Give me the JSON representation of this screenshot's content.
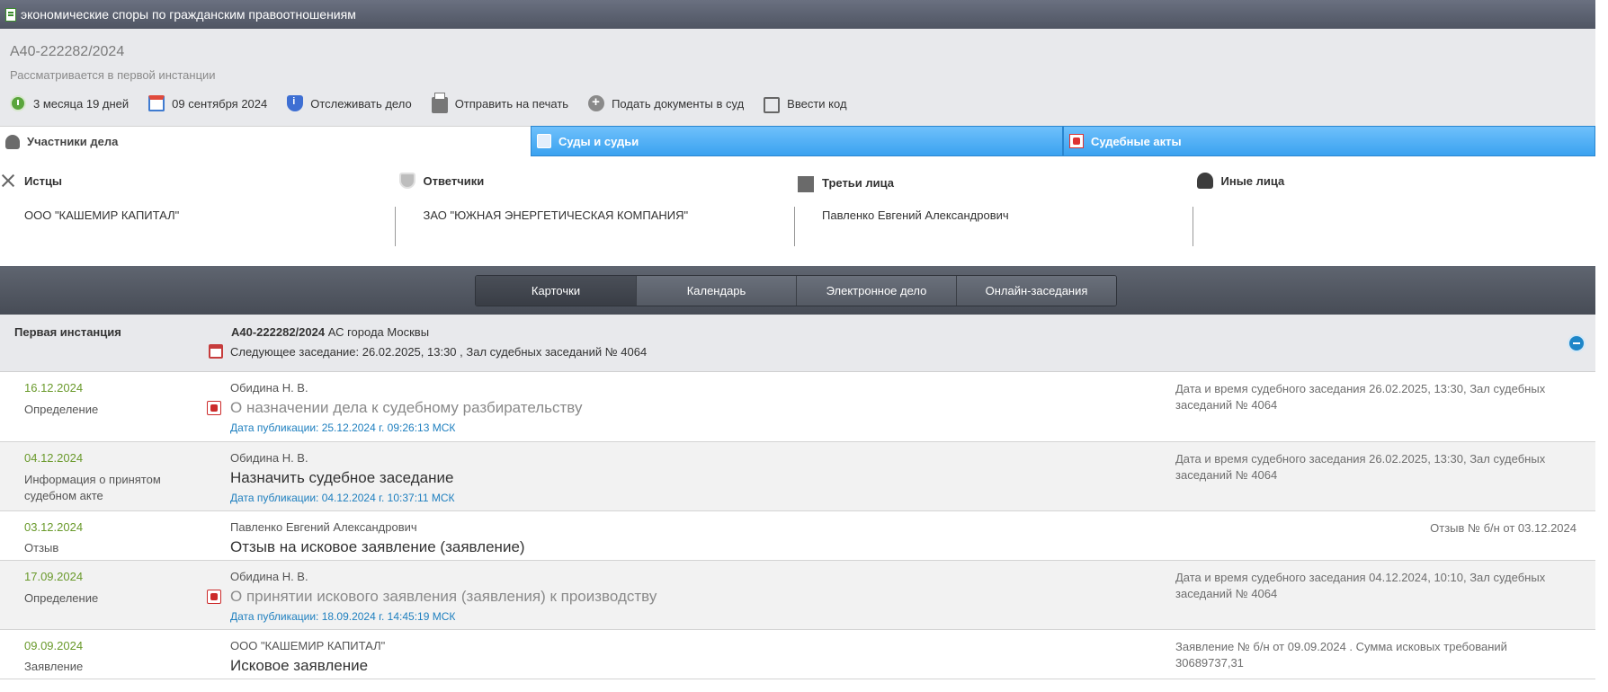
{
  "window": {
    "title": "экономические споры по гражданским правоотношениям"
  },
  "case": {
    "number": "А40-222282/2024",
    "status": "Рассматривается в первой инстанции",
    "actions": {
      "duration": "3 месяца 19 дней",
      "date": "09 сентября 2024",
      "track": "Отслеживать дело",
      "print": "Отправить на печать",
      "submit": "Подать документы в суд",
      "code": "Ввести код"
    }
  },
  "tabs": {
    "participants": "Участники дела",
    "courts": "Суды и судьи",
    "acts": "Судебные акты"
  },
  "participants": {
    "plaintiffs": {
      "label": "Истцы",
      "value": "ООО \"КАШЕМИР КАПИТАЛ\""
    },
    "defendants": {
      "label": "Ответчики",
      "value": "ЗАО \"ЮЖНАЯ ЭНЕРГЕТИЧЕСКАЯ КОМПАНИЯ\""
    },
    "third_parties": {
      "label": "Третьи лица",
      "value": "Павленко Евгений Александрович"
    },
    "others": {
      "label": "Иные лица",
      "value": ""
    }
  },
  "views": {
    "cards": "Карточки",
    "calendar": "Календарь",
    "electronic": "Электронное дело",
    "online": "Онлайн-заседания",
    "active": "cards"
  },
  "instance": {
    "name": "Первая инстанция",
    "case_number": "А40-222282/2024",
    "court": "АС города Москвы",
    "next_hearing": "Следующее заседание: 26.02.2025, 13:30 , Зал судебных заседаний № 4064"
  },
  "documents": [
    {
      "date": "16.12.2024",
      "type": "Определение",
      "judge": "Обидина Н. В.",
      "title": "О назначении дела к судебному разбирательству",
      "published": "Дата публикации: 25.12.2024 г. 09:26:13 МСК",
      "note": "Дата и время судебного заседания 26.02.2025, 13:30, Зал судебных заседаний № 4064"
    },
    {
      "date": "04.12.2024",
      "type": "Информация о принятом судебном акте",
      "judge": "Обидина Н. В.",
      "title": "Назначить судебное заседание",
      "published": "Дата публикации: 04.12.2024 г. 10:37:11 МСК",
      "note": "Дата и время судебного заседания 26.02.2025, 13:30, Зал судебных заседаний № 4064"
    },
    {
      "date": "03.12.2024",
      "type": "Отзыв",
      "judge": "Павленко Евгений Александрович",
      "title": "Отзыв на исковое заявление (заявление)",
      "note": "Отзыв № б/н от 03.12.2024"
    },
    {
      "date": "17.09.2024",
      "type": "Определение",
      "judge": "Обидина Н. В.",
      "title": "О принятии искового заявления (заявления) к производству",
      "published": "Дата публикации: 18.09.2024 г. 14:45:19 МСК",
      "note": "Дата и время судебного заседания 04.12.2024, 10:10, Зал судебных заседаний № 4064"
    },
    {
      "date": "09.09.2024",
      "type": "Заявление",
      "judge": "ООО \"КАШЕМИР КАПИТАЛ\"",
      "title": "Исковое заявление",
      "note": "Заявление № б/н от 09.09.2024 . Сумма исковых требований 30689737,31"
    }
  ]
}
